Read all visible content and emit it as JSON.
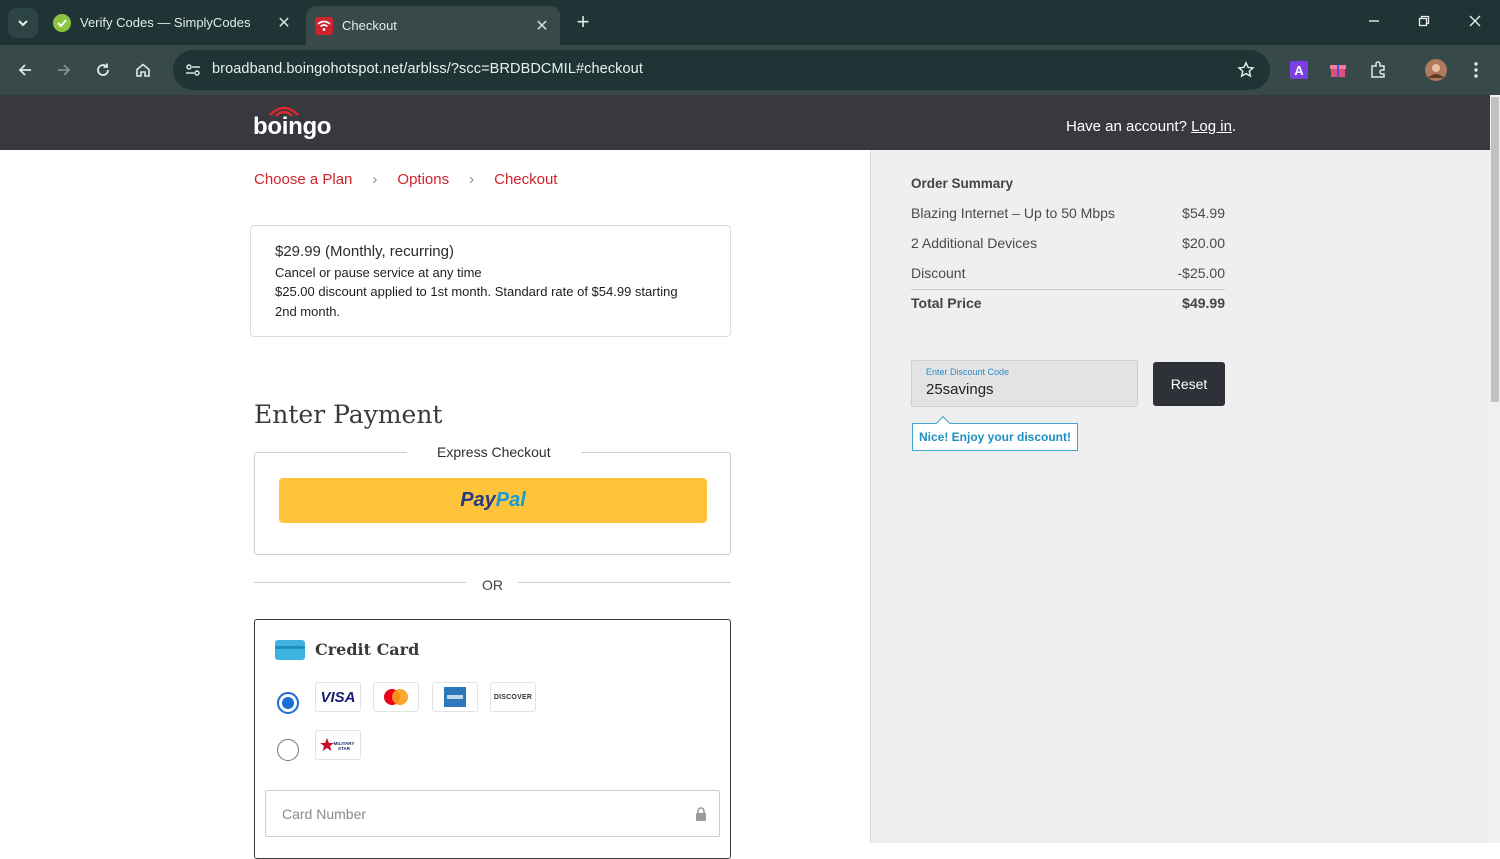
{
  "browser": {
    "tabs": [
      {
        "title": "Verify Codes — SimplyCodes",
        "favicon": "simplycodes-icon",
        "active": false
      },
      {
        "title": "Checkout",
        "favicon": "wifi-icon",
        "active": true
      }
    ],
    "url": "broadband.boingohotspot.net/arblss/?scc=BRDBDCMIL#checkout",
    "close_glyph": "✕",
    "newtab_glyph": "+",
    "window_controls": {
      "minimize": "—",
      "restore": "❐",
      "close": "✕"
    }
  },
  "header": {
    "logo_text": "boingo",
    "account_prompt": "Have an account?",
    "login_link": "Log in",
    "login_suffix": "."
  },
  "breadcrumb": {
    "items": [
      "Choose a Plan",
      "Options",
      "Checkout"
    ],
    "separator": "›"
  },
  "plan": {
    "price_line": "$29.99 (Monthly, recurring)",
    "cancel_line": "Cancel or pause service at any time",
    "discount_line": "$25.00 discount applied to 1st month. Standard rate of $54.99 starting 2nd month."
  },
  "payment": {
    "heading": "Enter Payment",
    "express_label": "Express Checkout",
    "paypal": {
      "pay": "Pay",
      "pal": "Pal"
    },
    "or_text": "OR",
    "credit_card_title": "Credit Card",
    "card_logos": [
      "VISA",
      "Mastercard",
      "American Express",
      "DISCOVER"
    ],
    "military_card": "MILITARY STAR",
    "card_number_placeholder": "Card Number",
    "selected_option": "visa-mastercard-amex-discover"
  },
  "order_summary": {
    "title": "Order Summary",
    "rows": [
      {
        "label": "Blazing Internet – Up to 50 Mbps",
        "amount": "$54.99"
      },
      {
        "label": "2 Additional Devices",
        "amount": "$20.00"
      },
      {
        "label": "Discount",
        "amount": "-$25.00"
      }
    ],
    "total_label": "Total Price",
    "total_amount": "$49.99"
  },
  "discount": {
    "label": "Enter Discount Code",
    "value": "25savings",
    "reset_label": "Reset",
    "message": "Nice! Enjoy your discount!"
  },
  "colors": {
    "brand_red": "#d0222d",
    "header_bg": "#38393e",
    "paypal_yellow": "#ffc43a",
    "accent_blue": "#1a6cd6",
    "message_blue": "#1f8fc0"
  }
}
